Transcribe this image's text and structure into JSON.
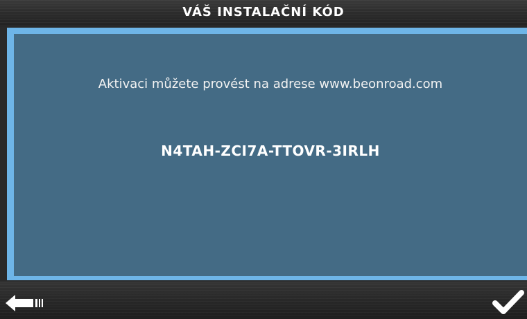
{
  "header": {
    "title": "VÁŠ INSTALAČNÍ KÓD"
  },
  "content": {
    "info": "Aktivaci můžete provést na adrese www.beonroad.com",
    "code": "N4TAH-ZCI7A-TTOVR-3IRLH"
  },
  "footer": {
    "back_icon": "back-arrow-icon",
    "confirm_icon": "checkmark-icon"
  },
  "colors": {
    "background": "#2a2a2a",
    "frame_border": "#6eb5e8",
    "panel": "#446b85",
    "text": "#ffffff"
  }
}
